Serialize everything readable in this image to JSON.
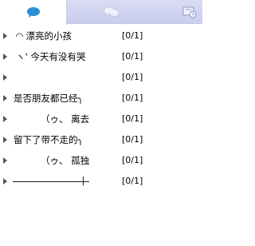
{
  "tabs": [
    {
      "icon": "chat-bubble-icon",
      "active": true
    },
    {
      "icon": "chat-bubbles-icon",
      "active": false
    },
    {
      "icon": "history-icon",
      "active": false
    }
  ],
  "groups": [
    {
      "name": "◜◝ 漂亮的小孩",
      "count": "[0/1]"
    },
    {
      "name": "ヽ' 今天有没有哭",
      "count": "[0/1]"
    },
    {
      "name": "",
      "count": "[0/1]"
    },
    {
      "name": "是否朋友都已经╮",
      "count": "[0/1]"
    },
    {
      "name": "（ゥ、 离去",
      "count": "[0/1]"
    },
    {
      "name": "留下了带不走的╮",
      "count": "[0/1]"
    },
    {
      "name": "（ゥ、 孤独",
      "count": "[0/1]"
    },
    {
      "name": "",
      "count": "[0/1]"
    }
  ],
  "colors": {
    "tab_bar": "#c9cdee",
    "tab_icon": "#2b8fd6",
    "tab_icon_inactive": "#f2f2fb"
  }
}
